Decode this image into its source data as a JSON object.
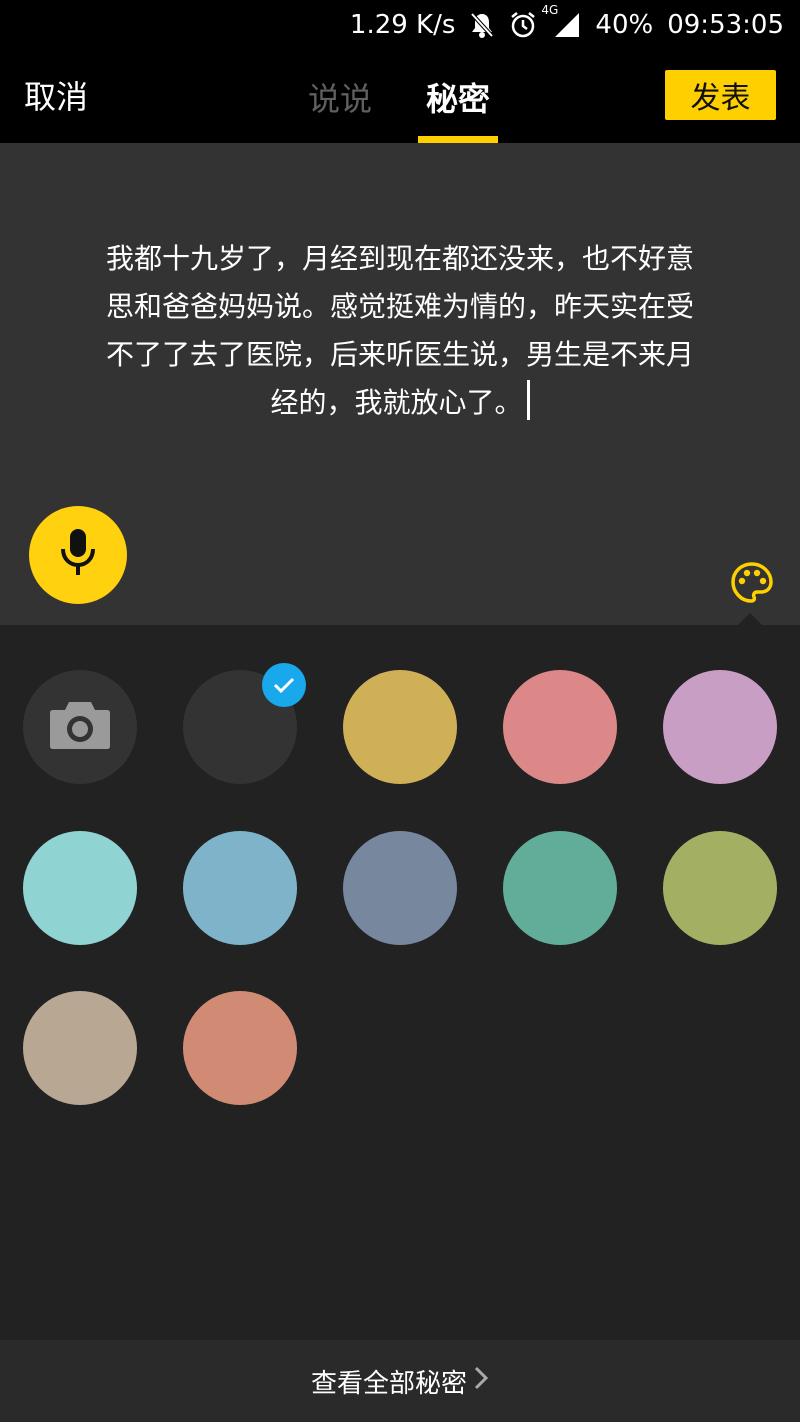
{
  "status_bar": {
    "network_speed": "1.29 K/s",
    "network_type": "4G",
    "battery": "40%",
    "time": "09:53:05",
    "icons": [
      "bell-off-icon",
      "alarm-icon",
      "signal-icon"
    ]
  },
  "header": {
    "cancel_label": "取消",
    "tabs": [
      {
        "label": "说说",
        "active": false
      },
      {
        "label": "秘密",
        "active": true
      }
    ],
    "publish_label": "发表",
    "accent_color": "#ffd000"
  },
  "editor": {
    "text": "我都十九岁了，月经到现在都还没来，也不好意思和爸爸妈妈说。感觉挺难为情的，昨天实在受不了了去了医院，后来听医生说，男生是不来月经的，我就放心了。",
    "background_color": "#333333",
    "mic_icon": "microphone-icon",
    "palette_icon": "palette-icon"
  },
  "colors": [
    {
      "name": "camera",
      "hex": "#333333",
      "icon": "camera-icon"
    },
    {
      "name": "dark",
      "hex": "#333333",
      "selected": true
    },
    {
      "name": "mustard",
      "hex": "#cfb057"
    },
    {
      "name": "rose",
      "hex": "#dc8889"
    },
    {
      "name": "lilac",
      "hex": "#c99ec4"
    },
    {
      "name": "aqua",
      "hex": "#8fd4d3"
    },
    {
      "name": "sky",
      "hex": "#7fb3ca"
    },
    {
      "name": "slate",
      "hex": "#76879e"
    },
    {
      "name": "teal",
      "hex": "#62ad99"
    },
    {
      "name": "olive",
      "hex": "#a3b064"
    },
    {
      "name": "sand",
      "hex": "#b7a793"
    },
    {
      "name": "salmon",
      "hex": "#d18a74"
    }
  ],
  "footer": {
    "link_label": "查看全部秘密"
  }
}
